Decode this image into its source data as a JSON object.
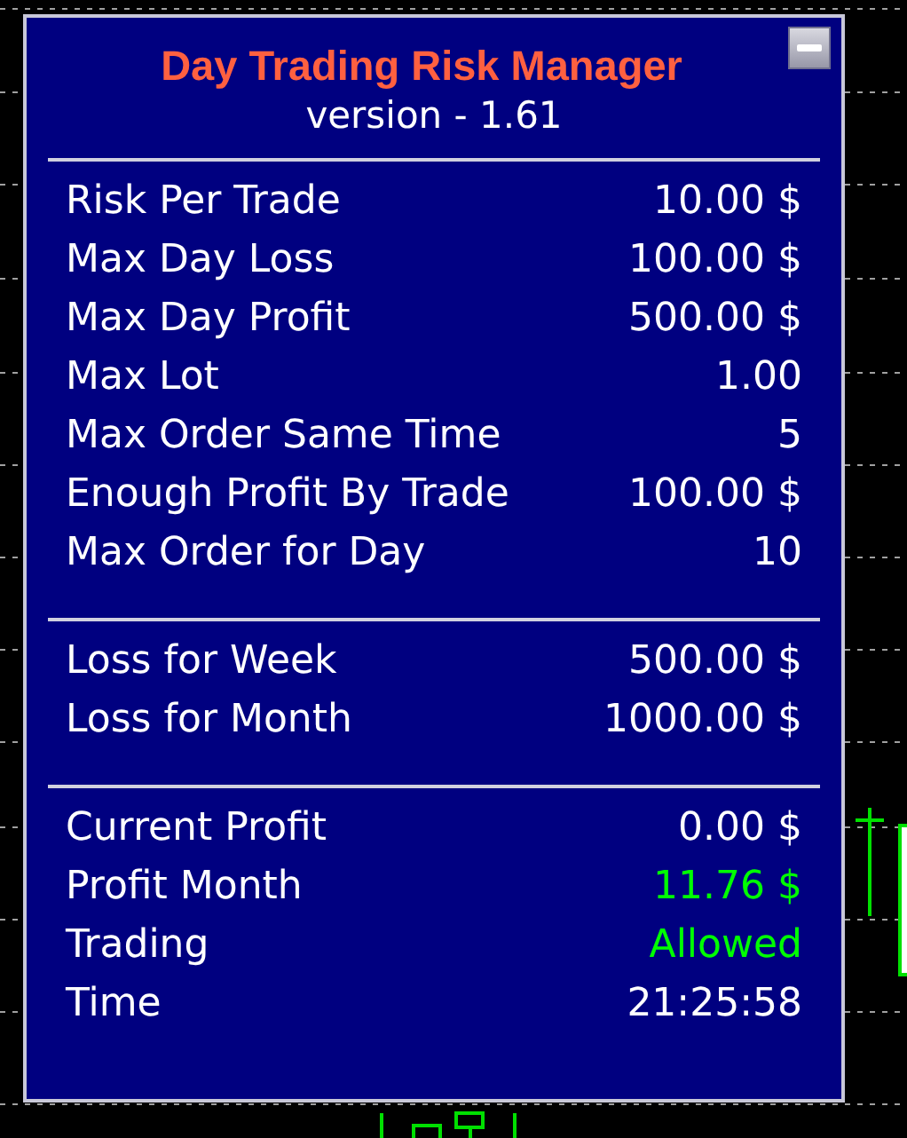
{
  "panel": {
    "title": "Day Trading Risk Manager",
    "subtitle": "version - 1.61",
    "sections": [
      {
        "rows": [
          {
            "label": "Risk Per Trade",
            "value": "10.00 $"
          },
          {
            "label": "Max Day Loss",
            "value": "100.00 $"
          },
          {
            "label": "Max Day Profit",
            "value": "500.00 $"
          },
          {
            "label": "Max Lot",
            "value": "1.00"
          },
          {
            "label": "Max Order Same Time",
            "value": "5"
          },
          {
            "label": "Enough Profit By Trade",
            "value": "100.00 $"
          },
          {
            "label": "Max Order for Day",
            "value": "10"
          }
        ]
      },
      {
        "rows": [
          {
            "label": "Loss for Week",
            "value": "500.00 $"
          },
          {
            "label": "Loss for Month",
            "value": "1000.00 $"
          }
        ]
      },
      {
        "rows": [
          {
            "label": "Current Profit",
            "value": "0.00 $",
            "color": "#ffffff"
          },
          {
            "label": "Profit Month",
            "value": "11.76 $",
            "color": "#00ff00"
          },
          {
            "label": "Trading",
            "value": "Allowed",
            "color": "#00ff00"
          },
          {
            "label": "Time",
            "value": "21:25:58",
            "color": "#ffffff"
          }
        ]
      }
    ]
  }
}
